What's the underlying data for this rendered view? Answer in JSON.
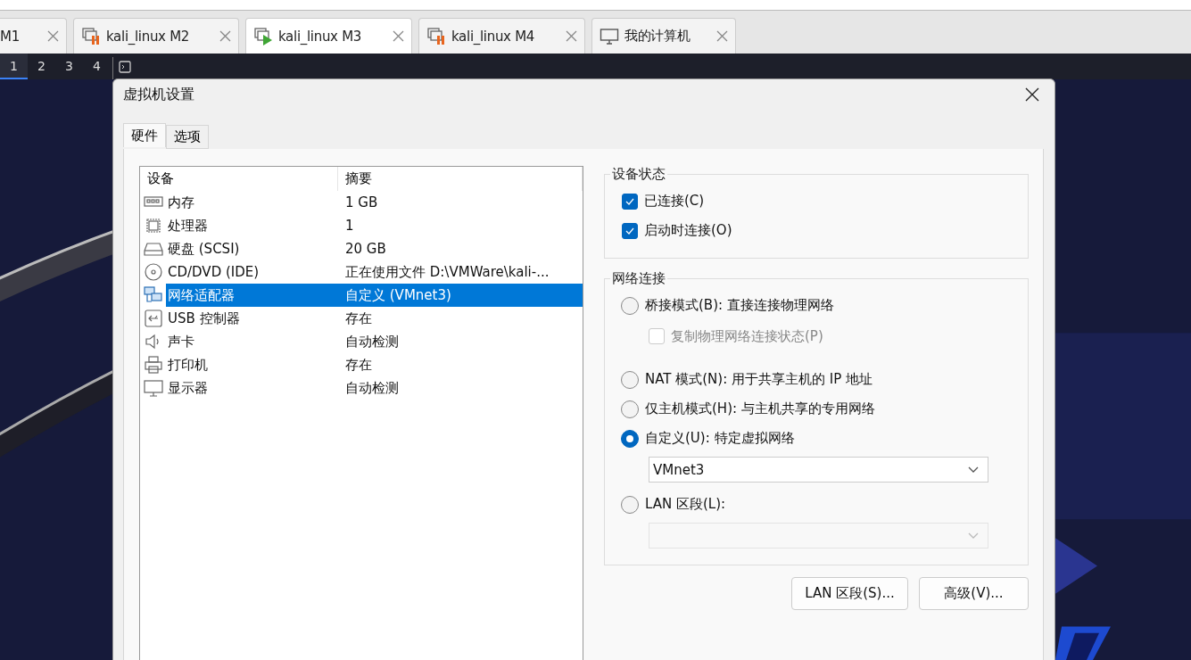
{
  "vm_tabs": [
    {
      "label": "M1",
      "kind": "cut",
      "selected": false
    },
    {
      "label": "kali_linux M2",
      "kind": "paused",
      "selected": false
    },
    {
      "label": "kali_linux M3",
      "kind": "running",
      "selected": true
    },
    {
      "label": "kali_linux M4",
      "kind": "paused",
      "selected": false
    },
    {
      "label": "我的计算机",
      "kind": "computer",
      "selected": false
    }
  ],
  "workspaces": [
    {
      "label": "1",
      "selected": true
    },
    {
      "label": "2",
      "selected": false
    },
    {
      "label": "3",
      "selected": false
    },
    {
      "label": "4",
      "selected": false
    }
  ],
  "dialog": {
    "title": "虚拟机设置",
    "tabs": [
      {
        "label": "硬件",
        "selected": true
      },
      {
        "label": "选项",
        "selected": false
      }
    ],
    "device_table": {
      "columns": [
        "设备",
        "摘要"
      ],
      "rows": [
        {
          "device": "内存",
          "summary": "1 GB",
          "kind": "memory",
          "selected": false
        },
        {
          "device": "处理器",
          "summary": "1",
          "kind": "cpu",
          "selected": false
        },
        {
          "device": "硬盘 (SCSI)",
          "summary": "20 GB",
          "kind": "disk",
          "selected": false
        },
        {
          "device": "CD/DVD (IDE)",
          "summary": "正在使用文件 D:\\VMWare\\kali-...",
          "kind": "cd",
          "selected": false
        },
        {
          "device": "网络适配器",
          "summary": "自定义 (VMnet3)",
          "kind": "network",
          "selected": true
        },
        {
          "device": "USB 控制器",
          "summary": "存在",
          "kind": "usb",
          "selected": false
        },
        {
          "device": "声卡",
          "summary": "自动检测",
          "kind": "sound",
          "selected": false
        },
        {
          "device": "打印机",
          "summary": "存在",
          "kind": "printer",
          "selected": false
        },
        {
          "device": "显示器",
          "summary": "自动检测",
          "kind": "display",
          "selected": false
        }
      ]
    },
    "device_status": {
      "title": "设备状态",
      "checkboxes": [
        {
          "label": "已连接(C)",
          "checked": true
        },
        {
          "label": "启动时连接(O)",
          "checked": true
        }
      ]
    },
    "network_connection": {
      "title": "网络连接",
      "items": [
        {
          "kind": "radio",
          "label": "桥接模式(B): 直接连接物理网络",
          "selected": false
        },
        {
          "kind": "checkbox",
          "label": "复制物理网络连接状态(P)",
          "checked": false,
          "disabled": true
        },
        {
          "kind": "radio",
          "label": "NAT 模式(N): 用于共享主机的 IP 地址",
          "selected": false
        },
        {
          "kind": "radio",
          "label": "仅主机模式(H): 与主机共享的专用网络",
          "selected": false
        },
        {
          "kind": "radio",
          "label": "自定义(U): 特定虚拟网络",
          "selected": true
        },
        {
          "kind": "select",
          "value": "VMnet3",
          "disabled": false
        },
        {
          "kind": "radio",
          "label": "LAN 区段(L):",
          "selected": false
        },
        {
          "kind": "select",
          "disabled": true
        }
      ]
    },
    "buttons": [
      "LAN 区段(S)...",
      "高级(V)..."
    ]
  }
}
